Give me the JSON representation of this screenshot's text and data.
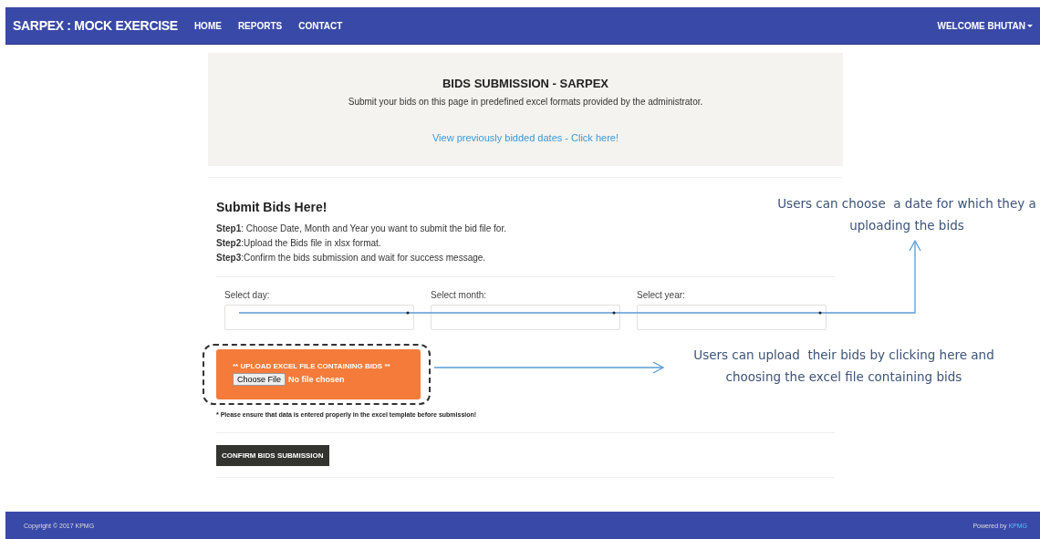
{
  "navbar": {
    "brand": "SARPEX : MOCK EXERCISE",
    "links": [
      {
        "label": "HOME"
      },
      {
        "label": "REPORTS"
      },
      {
        "label": "CONTACT"
      }
    ],
    "user_menu": "WELCOME BHUTAN"
  },
  "header": {
    "title": "BIDS SUBMISSION - SARPEX",
    "subtitle": "Submit your bids on this page in predefined excel formats provided by the administrator.",
    "link": "View previously bidded dates - Click here!"
  },
  "instructions": {
    "title": "Submit Bids Here!",
    "steps": [
      "**Step1**: Choose Date, Month and Year you want to submit the bid file for.",
      "**Step2**:Upload the Bids file in xlsx format.",
      "**Step3**:Confirm the bids submission and wait for success message."
    ]
  },
  "date_fields": [
    {
      "label": "Select day:"
    },
    {
      "label": "Select month:"
    },
    {
      "label": "Select year:"
    }
  ],
  "upload": {
    "title": "** UPLOAD EXCEL FILE CONTAINING BIDS **",
    "button": "Choose File",
    "status": "No file chosen"
  },
  "note": "* Please ensure that data is entered properly in the excel template before submission!",
  "submit_button": "CONFIRM BIDS SUBMISSION",
  "annotations": [
    {
      "lines": [
        "Users can choose  a date for which they a",
        "uploading the bids"
      ]
    },
    {
      "lines": [
        "Users can upload  their bids by clicking here and",
        "choosing the excel file containing bids"
      ]
    }
  ],
  "footer": {
    "copyright": "Copyright © 2017 KPMG",
    "powered_prefix": "Powered by",
    "powered_link": "KPMG"
  }
}
